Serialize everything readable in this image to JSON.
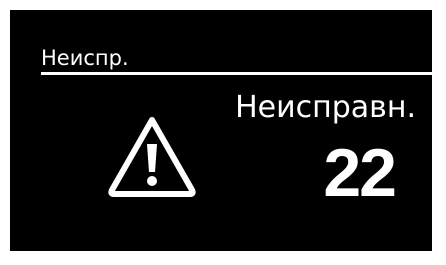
{
  "screen": {
    "header_title": "Неиспр.",
    "fault_label": "Неисправн.",
    "fault_count": "22",
    "icon": "warning-triangle-icon",
    "colors": {
      "background": "#000000",
      "foreground": "#ffffff",
      "bezel": "#ffffff"
    }
  }
}
